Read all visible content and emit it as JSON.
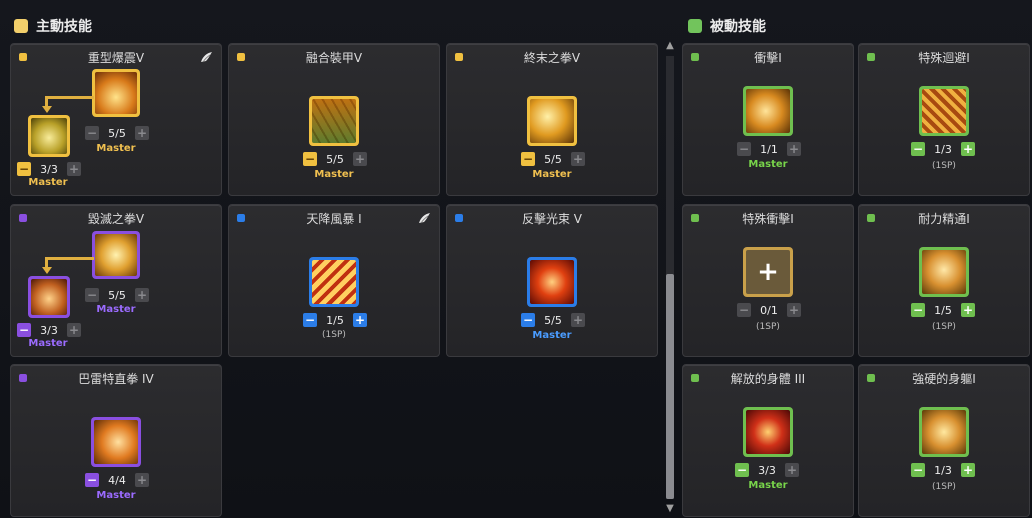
{
  "sections": {
    "active": {
      "title": "主動技能",
      "color": "#f2cf6b"
    },
    "passive": {
      "title": "被動技能",
      "color": "#72c45c"
    }
  },
  "colors": {
    "gold": "#f0c040",
    "purple": "#8a4fe0",
    "blue": "#2b7de8",
    "green": "#6fbf4f",
    "master_gold": "#f0c050",
    "master_purple": "#9b6bff",
    "master_blue": "#4a9cff",
    "master_green": "#78d44a"
  },
  "active_skills": [
    {
      "name": "重型爆震V",
      "tier": "gold",
      "wing": true,
      "main": {
        "level": "5/5",
        "sub": "Master"
      },
      "child": {
        "level": "3/3",
        "sub": "Master"
      }
    },
    {
      "name": "融合裝甲V",
      "tier": "gold",
      "main": {
        "level": "5/5",
        "sub": "Master"
      }
    },
    {
      "name": "終末之拳V",
      "tier": "gold",
      "main": {
        "level": "5/5",
        "sub": "Master"
      }
    },
    {
      "name": "毀滅之拳V",
      "tier": "purple",
      "main": {
        "level": "5/5",
        "sub": "Master"
      },
      "child": {
        "level": "3/3",
        "sub": "Master"
      }
    },
    {
      "name": "天降風暴 I",
      "tier": "blue",
      "wing": true,
      "main": {
        "level": "1/5",
        "sub": "(1SP)"
      }
    },
    {
      "name": "反擊光束 V",
      "tier": "blue",
      "main": {
        "level": "5/5",
        "sub": "Master"
      }
    },
    {
      "name": "巴雷特直拳 IV",
      "tier": "purple",
      "main": {
        "level": "4/4",
        "sub": "Master"
      }
    }
  ],
  "passive_skills": [
    {
      "name": "衝擊I",
      "level": "1/1",
      "sub": "Master"
    },
    {
      "name": "特殊迴避I",
      "level": "1/3",
      "sub": "(1SP)"
    },
    {
      "name": "特殊衝擊I",
      "level": "0/1",
      "sub": "(1SP)"
    },
    {
      "name": "耐力精通I",
      "level": "1/5",
      "sub": "(1SP)"
    },
    {
      "name": "解放的身體 III",
      "level": "3/3",
      "sub": "Master"
    },
    {
      "name": "強硬的身軀I",
      "level": "1/3",
      "sub": "(1SP)"
    }
  ],
  "icons": {
    "minus": "−",
    "plus": "+",
    "add_skill": "+",
    "scroll_up": "▲",
    "scroll_down": "▼"
  }
}
